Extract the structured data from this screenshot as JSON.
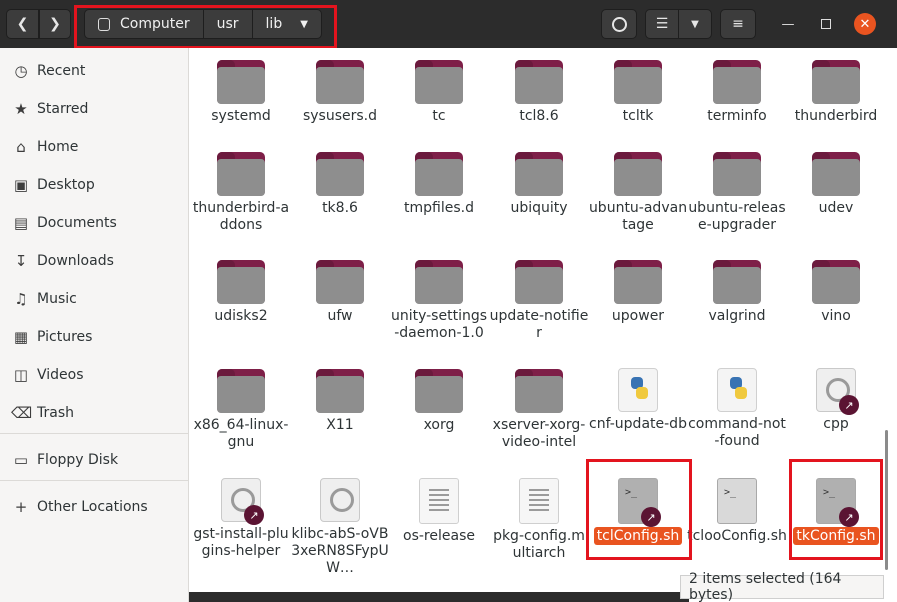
{
  "header": {
    "back_icon": "chevron-left-icon",
    "forward_icon": "chevron-right-icon",
    "breadcrumbs": [
      "Computer",
      "usr",
      "lib"
    ],
    "search_icon": "search-icon",
    "view_icon": "list-view-icon",
    "menu_icon": "hamburger-icon"
  },
  "sidebar": {
    "items": [
      {
        "label": "Recent",
        "icon": "clock-icon"
      },
      {
        "label": "Starred",
        "icon": "star-icon"
      },
      {
        "label": "Home",
        "icon": "home-icon"
      },
      {
        "label": "Desktop",
        "icon": "desktop-icon"
      },
      {
        "label": "Documents",
        "icon": "document-icon"
      },
      {
        "label": "Downloads",
        "icon": "download-icon"
      },
      {
        "label": "Music",
        "icon": "music-icon"
      },
      {
        "label": "Pictures",
        "icon": "picture-icon"
      },
      {
        "label": "Videos",
        "icon": "video-icon"
      },
      {
        "label": "Trash",
        "icon": "trash-icon"
      },
      {
        "label": "Floppy Disk",
        "icon": "floppy-icon"
      },
      {
        "label": "Other Locations",
        "icon": "plus-icon"
      }
    ]
  },
  "files": [
    {
      "name": "systemd",
      "type": "folder"
    },
    {
      "name": "sysusers.d",
      "type": "folder"
    },
    {
      "name": "tc",
      "type": "folder"
    },
    {
      "name": "tcl8.6",
      "type": "folder"
    },
    {
      "name": "tcltk",
      "type": "folder"
    },
    {
      "name": "terminfo",
      "type": "folder"
    },
    {
      "name": "thunderbird",
      "type": "folder"
    },
    {
      "name": "thunderbird-addons",
      "type": "folder"
    },
    {
      "name": "tk8.6",
      "type": "folder"
    },
    {
      "name": "tmpfiles.d",
      "type": "folder"
    },
    {
      "name": "ubiquity",
      "type": "folder"
    },
    {
      "name": "ubuntu-advantage",
      "type": "folder"
    },
    {
      "name": "ubuntu-release-upgrader",
      "type": "folder"
    },
    {
      "name": "udev",
      "type": "folder"
    },
    {
      "name": "udisks2",
      "type": "folder"
    },
    {
      "name": "ufw",
      "type": "folder"
    },
    {
      "name": "unity-settings-daemon-1.0",
      "type": "folder"
    },
    {
      "name": "update-notifier",
      "type": "folder"
    },
    {
      "name": "upower",
      "type": "folder"
    },
    {
      "name": "valgrind",
      "type": "folder"
    },
    {
      "name": "vino",
      "type": "folder"
    },
    {
      "name": "x86_64-linux-gnu",
      "type": "folder"
    },
    {
      "name": "X11",
      "type": "folder"
    },
    {
      "name": "xorg",
      "type": "folder"
    },
    {
      "name": "xserver-xorg-video-intel",
      "type": "folder"
    },
    {
      "name": "cnf-update-db",
      "type": "python"
    },
    {
      "name": "command-not-found",
      "type": "python"
    },
    {
      "name": "cpp",
      "type": "gear-link"
    },
    {
      "name": "gst-install-plugins-helper",
      "type": "gear-link"
    },
    {
      "name": "klibc-abS-oVB3xeRN8SFypUW…",
      "type": "gear"
    },
    {
      "name": "os-release",
      "type": "text"
    },
    {
      "name": "pkg-config.multiarch",
      "type": "text"
    },
    {
      "name": "tclConfig.sh",
      "type": "script-link",
      "selected": true
    },
    {
      "name": "tclooConfig.sh",
      "type": "script"
    },
    {
      "name": "tkConfig.sh",
      "type": "script-link",
      "selected": true
    }
  ],
  "status": {
    "text": "2 items selected (164 bytes)"
  },
  "colors": {
    "accent": "#e95420",
    "folder": "#7e1f48",
    "highlight": "#e3141e"
  }
}
